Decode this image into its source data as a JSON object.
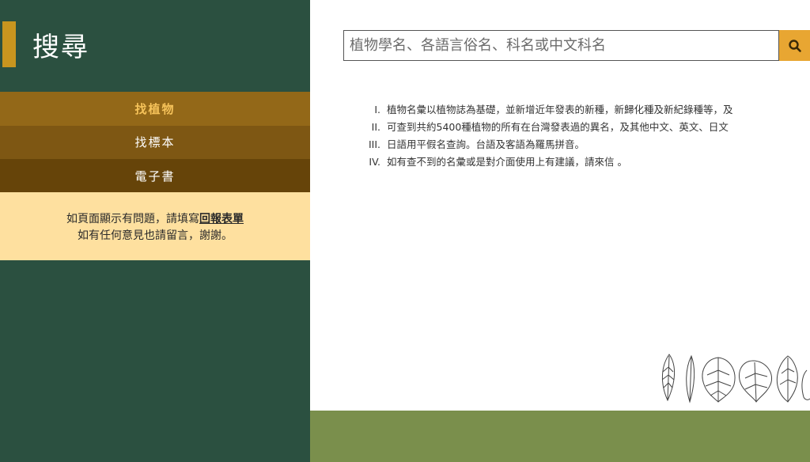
{
  "sidebar": {
    "title": "搜尋",
    "nav": [
      {
        "label": "找植物",
        "active": true
      },
      {
        "label": "找標本",
        "active": false
      },
      {
        "label": "電子書",
        "active": false
      }
    ],
    "notice": {
      "line1_prefix": "如頁面顯示有問題，請填寫",
      "line1_link": "回報表單",
      "line2": "如有任何意見也請留言，謝謝。"
    }
  },
  "search": {
    "placeholder": "植物學名、各語言俗名、科名或中文科名",
    "button_icon": "search-icon"
  },
  "info": [
    {
      "num": "I.",
      "text": "植物名彙以植物誌為基礎，並新增近年發表的新種，新歸化種及新紀錄種等，及"
    },
    {
      "num": "II.",
      "text": "可查到共約5400種植物的所有在台灣發表過的異名，及其他中文、英文、日文"
    },
    {
      "num": "III.",
      "text": "日語用平假名查詢。台語及客語為羅馬拼音。"
    },
    {
      "num": "IV.",
      "text": "如有查不到的名彙或是對介面使用上有建議，請來信 。"
    }
  ],
  "colors": {
    "sidebar_bg": "#2b5040",
    "accent": "#c8951f",
    "search_button": "#e8a632",
    "notice_bg": "#fee09f",
    "footer": "#7a8f4c"
  }
}
